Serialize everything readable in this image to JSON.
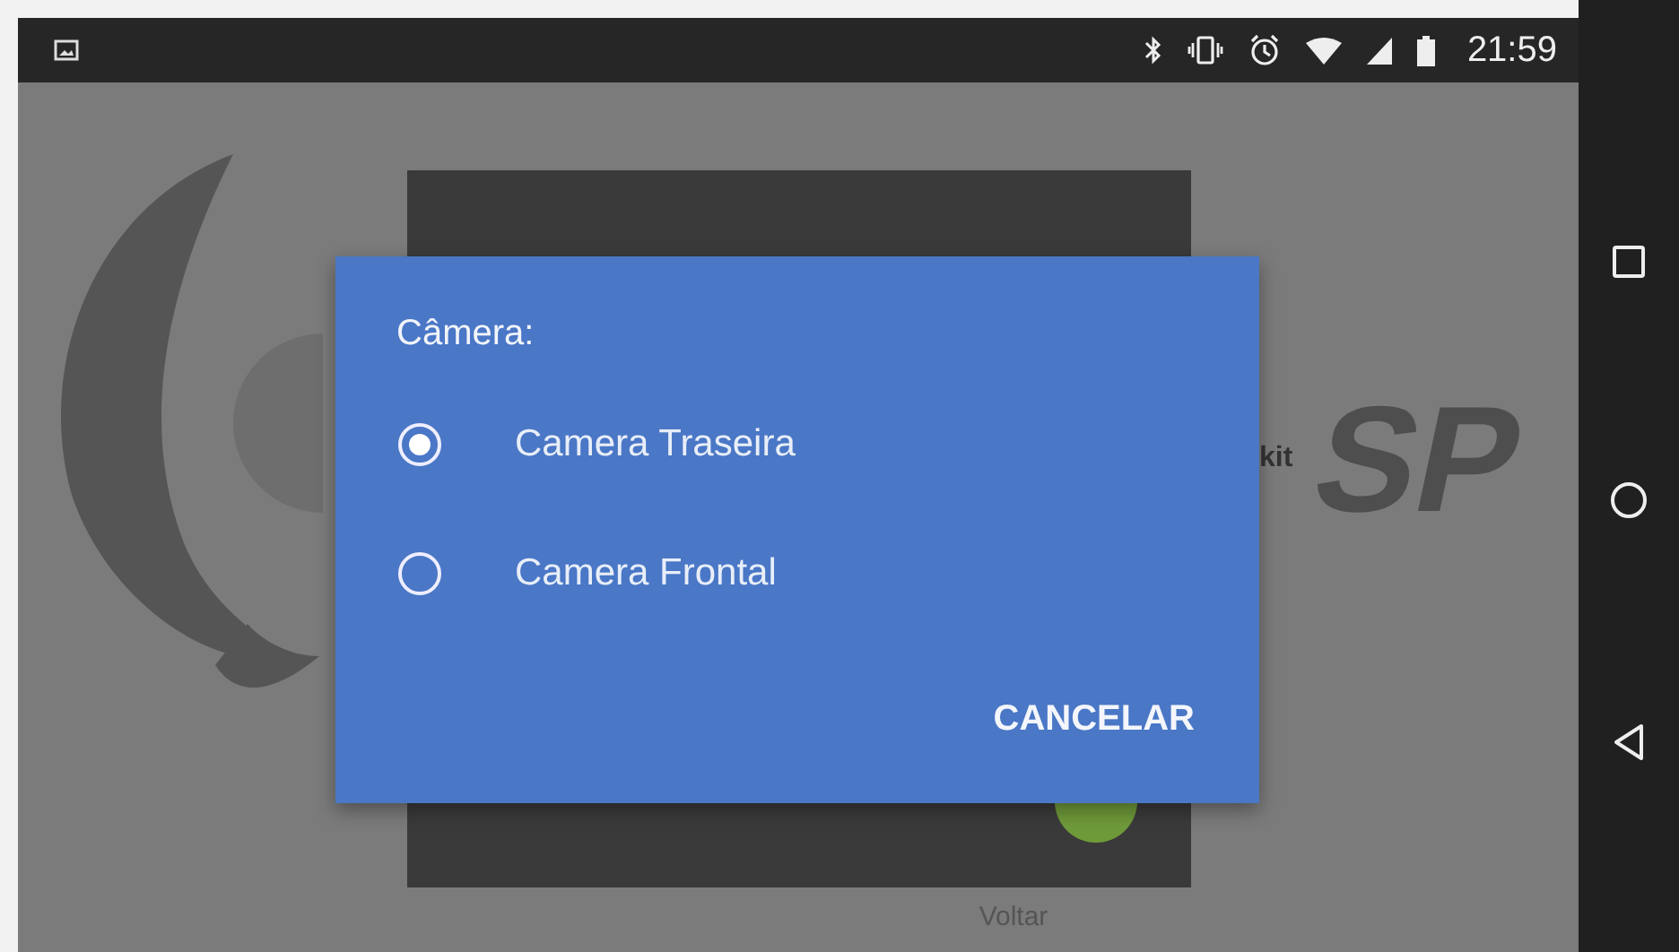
{
  "status_bar": {
    "time": "21:59"
  },
  "background": {
    "logo_text": "SP",
    "logo_caption": "kit",
    "button_label": "Voltar"
  },
  "dialog": {
    "title": "Câmera:",
    "options": [
      {
        "label": "Camera Traseira",
        "selected": true
      },
      {
        "label": "Camera Frontal",
        "selected": false
      }
    ],
    "buttons": [
      "CANCELAR"
    ]
  }
}
